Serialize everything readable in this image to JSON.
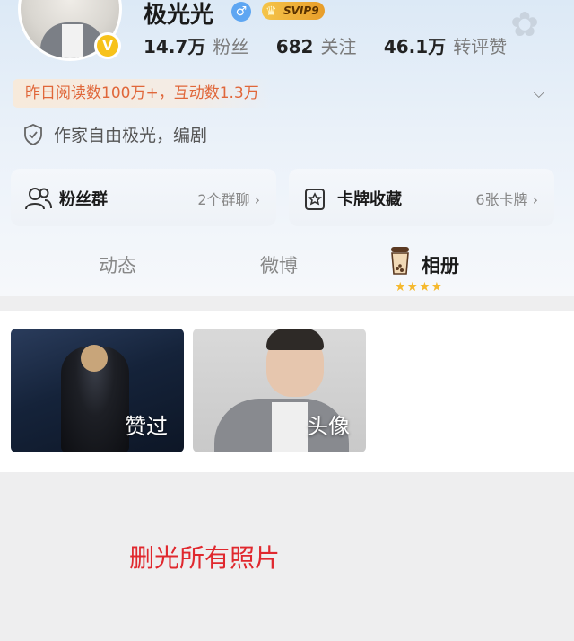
{
  "profile": {
    "username": "极光光",
    "gender_icon": "male-icon",
    "vip_badge": "SVIP9",
    "verified_icon": "verified-v-icon",
    "stats": [
      {
        "value": "14.7万",
        "label": "粉丝"
      },
      {
        "value": "682",
        "label": "关注"
      },
      {
        "value": "46.1万",
        "label": "转评赞"
      }
    ],
    "banner": "昨日阅读数100万+，互动数1.3万",
    "bio": "作家自由极光，编剧"
  },
  "cards": {
    "fans": {
      "title": "粉丝群",
      "meta": "2个群聊",
      "icon": "fan-group-icon"
    },
    "collection": {
      "title": "卡牌收藏",
      "meta": "6张卡牌",
      "icon": "card-collection-icon"
    }
  },
  "tabs": [
    {
      "label": "动态",
      "active": false
    },
    {
      "label": "微博",
      "active": false
    },
    {
      "label": "相册",
      "active": true
    }
  ],
  "album_rating": "★★★★",
  "album": [
    {
      "label": "赞过"
    },
    {
      "label": "头像"
    }
  ],
  "caption": "删光所有照片",
  "colors": {
    "accent_orange": "#e0673a",
    "caption_red": "#e0282e",
    "vip_gold": "#f5c54a",
    "verified_yellow": "#f7c21b"
  }
}
